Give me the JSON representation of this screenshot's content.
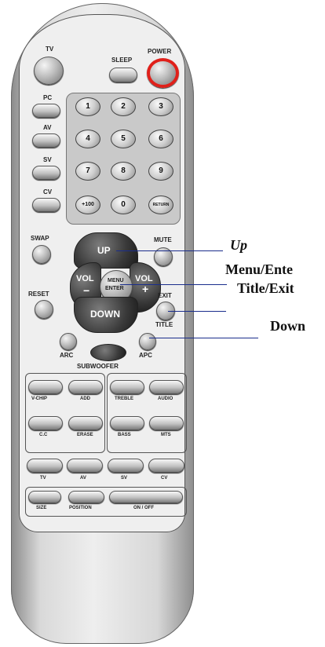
{
  "remote": {
    "top_buttons": {
      "tv": "TV",
      "sleep": "SLEEP",
      "power": "POWER",
      "pc": "PC",
      "av": "AV",
      "sv": "SV",
      "cv": "CV"
    },
    "keypad": [
      "1",
      "2",
      "3",
      "4",
      "5",
      "6",
      "7",
      "8",
      "9",
      "+100",
      "0",
      "RETURN"
    ],
    "nav": {
      "swap": "SWAP",
      "mute": "MUTE",
      "up": "UP",
      "vol_minus_top": "VOL",
      "vol_minus_sign": "−",
      "vol_plus_top": "VOL",
      "vol_plus_sign": "+",
      "menu": "MENU",
      "enter": "ENTER",
      "reset": "RESET",
      "exit": "EXIT",
      "title": "TITLE",
      "down": "DOWN",
      "arc": "ARC",
      "apc": "APC",
      "subwoofer": "SUBWOOFER"
    },
    "function_keys": {
      "vchip": "V-CHIP",
      "add": "ADD",
      "treble": "TREBLE",
      "audio": "AUDIO",
      "cc": "C.C",
      "erase": "ERASE",
      "bass": "BASS",
      "mts": "MTS"
    },
    "source_keys": [
      "TV",
      "AV",
      "SV",
      "CV"
    ],
    "bottom_keys": {
      "size": "SIZE",
      "position": "POSITION",
      "onoff": "ON / OFF"
    }
  },
  "callouts": {
    "up": "Up",
    "menu_enter": "Menu/Ente",
    "title_exit": "Title/Exit",
    "down": "Down"
  },
  "colors": {
    "power_ring": "#e0201a",
    "callout_line": "#1a2d8c"
  }
}
